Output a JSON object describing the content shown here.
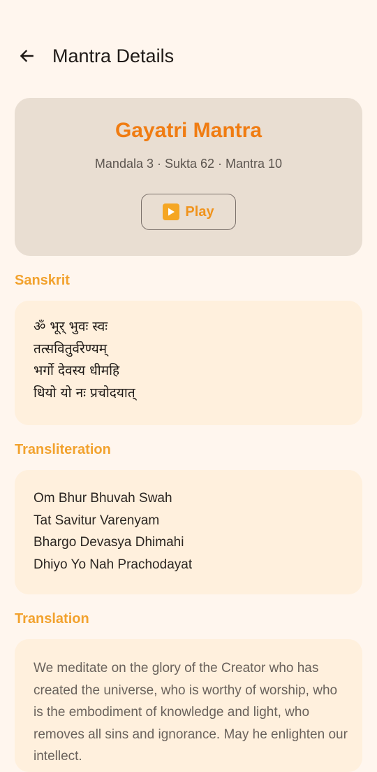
{
  "header": {
    "title": "Mantra Details",
    "back_icon": "arrow-left-icon"
  },
  "mantra": {
    "name": "Gayatri Mantra",
    "reference": "Mandala 3 · Sukta 62 · Mantra 10",
    "play_label": "Play",
    "play_icon": "play-emoji-icon"
  },
  "sections": {
    "sanskrit": {
      "label": "Sanskrit",
      "lines": [
        "ॐ भूर् भुवः स्वः",
        "तत्सवितुर्वरेण्यम्",
        "भर्गो देवस्य धीमहि",
        "धियो यो नः प्रचोदयात्"
      ]
    },
    "transliteration": {
      "label": "Transliteration",
      "lines": [
        "Om Bhur Bhuvah Swah",
        "Tat Savitur Varenyam",
        "Bhargo Devasya Dhimahi",
        "Dhiyo Yo Nah Prachodayat"
      ]
    },
    "translation": {
      "label": "Translation",
      "text": "We meditate on the glory of the Creator who has created the universe, who is worthy of worship, who is the embodiment of knowledge and light, who removes all sins and ignorance. May he enlighten our intellect."
    }
  },
  "colors": {
    "background": "#fff6ee",
    "accent": "#f07c12",
    "section_label": "#f2a22e",
    "hero_card": "#e9ded2",
    "content_card": "#fff0dd"
  }
}
